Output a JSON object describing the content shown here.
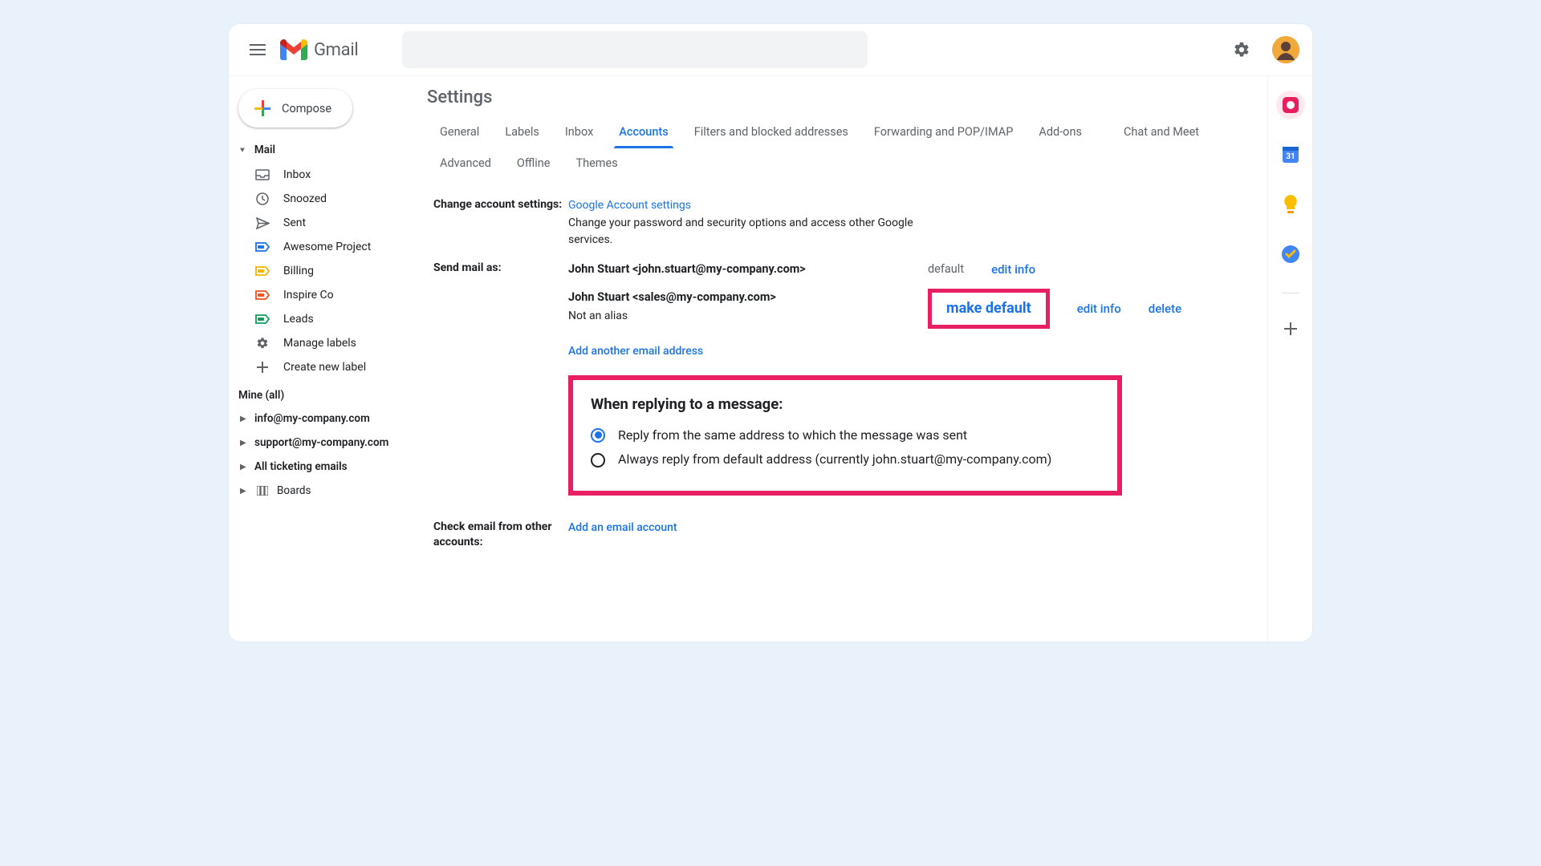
{
  "app": {
    "name": "Gmail"
  },
  "header": {
    "compose": "Compose"
  },
  "sidebar": {
    "mail_header": "Mail",
    "items": [
      {
        "icon": "inbox",
        "label": "Inbox"
      },
      {
        "icon": "snoozed",
        "label": "Snoozed"
      },
      {
        "icon": "sent",
        "label": "Sent"
      },
      {
        "icon": "label-blue",
        "label": "Awesome Project"
      },
      {
        "icon": "label-yellow",
        "label": "Billing"
      },
      {
        "icon": "label-orange",
        "label": "Inspire Co"
      },
      {
        "icon": "label-green",
        "label": "Leads"
      },
      {
        "icon": "manage",
        "label": "Manage labels"
      },
      {
        "icon": "create",
        "label": "Create new label"
      }
    ],
    "mine_header": "Mine (all)",
    "mine": [
      {
        "label": "info@my-company.com"
      },
      {
        "label": "support@my-company.com"
      },
      {
        "label": "All ticketing emails"
      },
      {
        "label": "Boards",
        "icon": "boards"
      }
    ]
  },
  "page": {
    "title": "Settings",
    "tabs": [
      "General",
      "Labels",
      "Inbox",
      "Accounts",
      "Filters and blocked addresses",
      "Forwarding and POP/IMAP",
      "Add-ons",
      "Chat and Meet",
      "Advanced",
      "Offline",
      "Themes"
    ],
    "active_tab": "Accounts"
  },
  "sections": {
    "change": {
      "label": "Change account settings:",
      "link": "Google Account settings",
      "desc": "Change your password and security options and access other Google services."
    },
    "send": {
      "label": "Send mail as:",
      "rows": [
        {
          "who": "John Stuart <john.stuart@my-company.com>",
          "default": "default",
          "edit": "edit info"
        },
        {
          "who": "John Stuart <sales@my-company.com>",
          "sub": "Not an alias",
          "make_default": "make default",
          "edit": "edit info",
          "delete": "delete"
        }
      ],
      "add": "Add another email address"
    },
    "reply": {
      "title": "When replying to a message:",
      "options": [
        {
          "selected": true,
          "label": "Reply from the same address to which the message was sent"
        },
        {
          "selected": false,
          "label": "Always reply from default address (currently john.stuart@my-company.com)"
        }
      ]
    },
    "check": {
      "label": "Check email from other accounts:",
      "add": "Add an email account"
    }
  }
}
